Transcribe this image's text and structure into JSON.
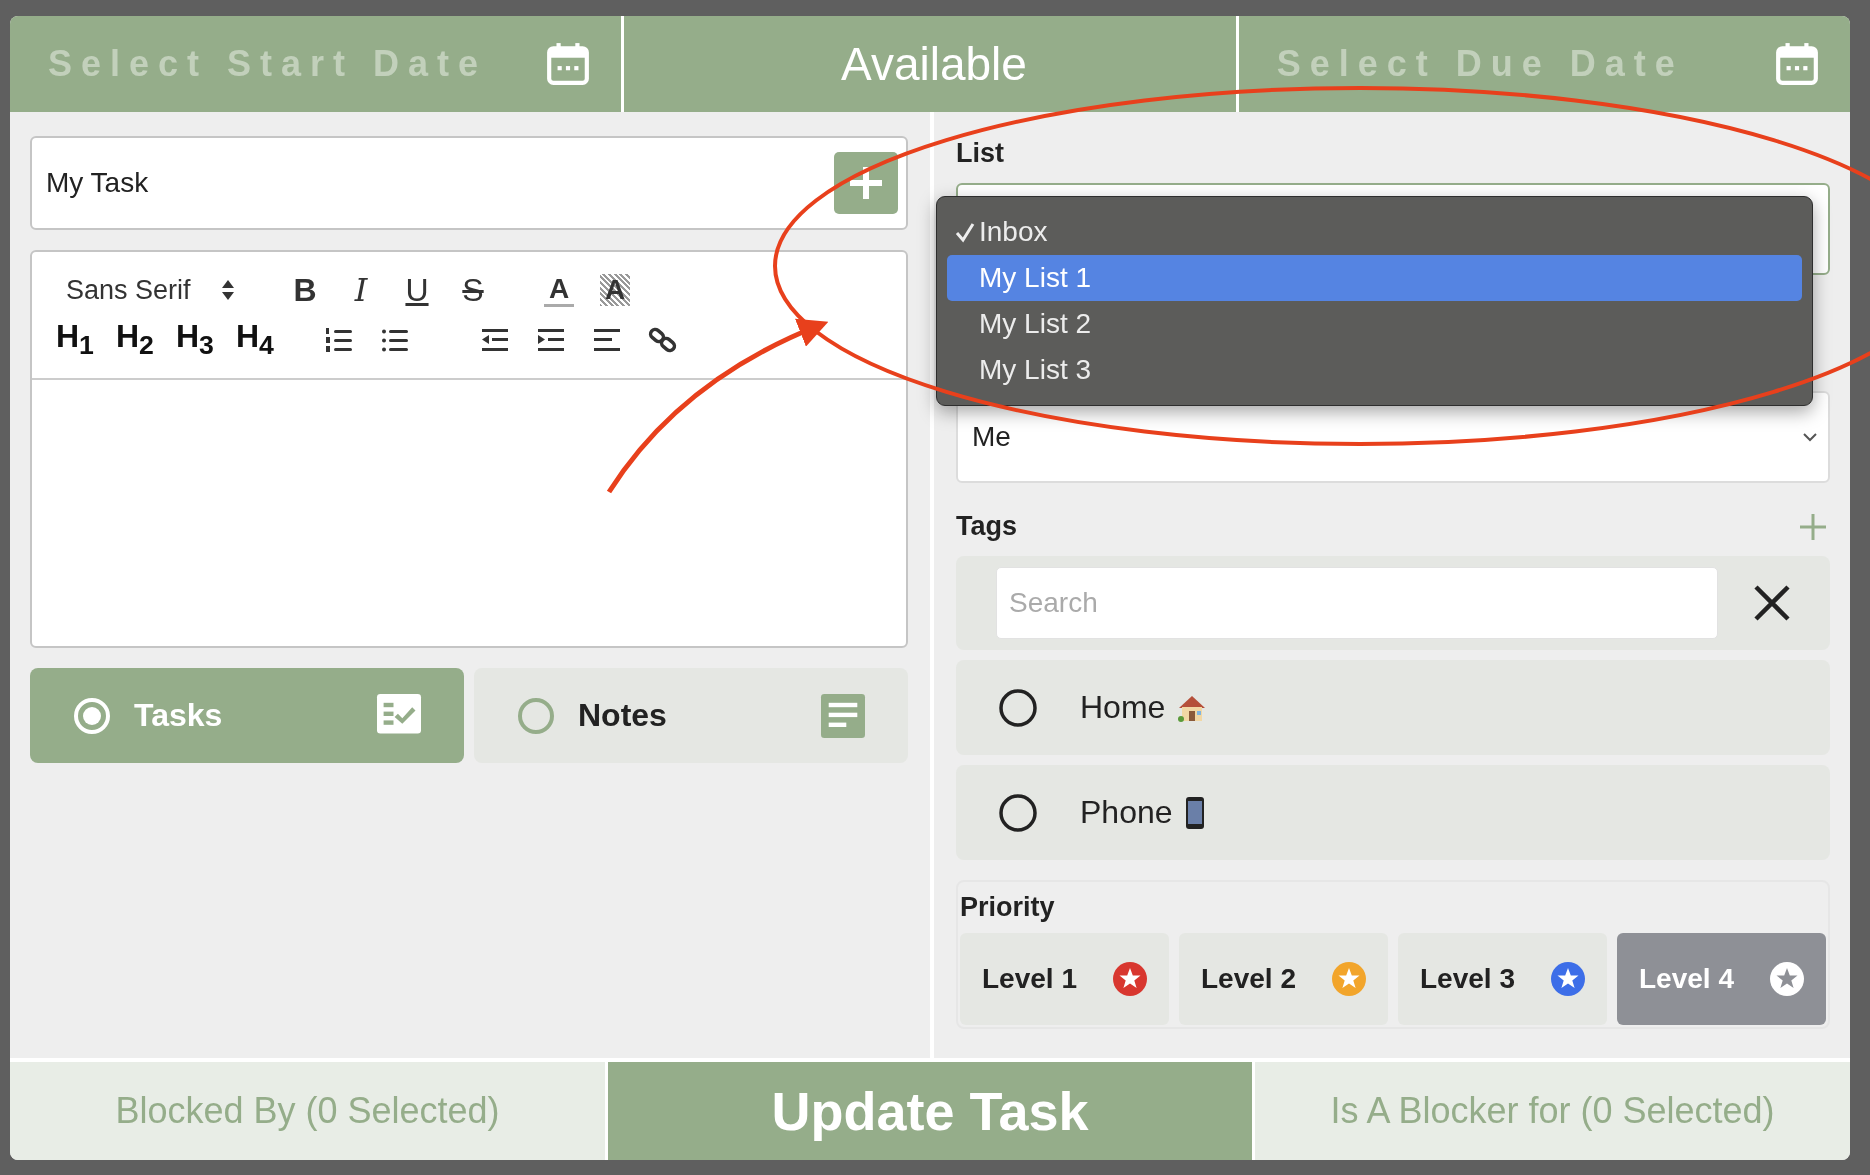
{
  "header": {
    "start_date": {
      "placeholder": "Select Start Date"
    },
    "status": "Available",
    "due_date": {
      "placeholder": "Select Due Date"
    }
  },
  "title_field": {
    "value": "My Task"
  },
  "editor": {
    "font": "Sans Serif",
    "format_buttons": [
      "B",
      "I",
      "U",
      "S",
      "A",
      "A"
    ],
    "headings": [
      "H$_{1}$",
      "H$_{2}$",
      "H$_{3}$",
      "H$_{4}$"
    ]
  },
  "type_options": [
    {
      "label": "Tasks",
      "selected": true
    },
    {
      "label": "Notes",
      "selected": false
    }
  ],
  "list": {
    "label": "List",
    "menu": [
      {
        "label": "Inbox",
        "checked": true,
        "highlighted": false
      },
      {
        "label": "My List 1",
        "checked": false,
        "highlighted": true
      },
      {
        "label": "My List 2",
        "checked": false,
        "highlighted": false
      },
      {
        "label": "My List 3",
        "checked": false,
        "highlighted": false
      }
    ]
  },
  "assignee": {
    "value": "Me"
  },
  "tags": {
    "label": "Tags",
    "search": {
      "placeholder": "Search"
    },
    "items": [
      {
        "label": "Home",
        "kind": "house",
        "selected": false
      },
      {
        "label": "Phone",
        "kind": "phone",
        "selected": false
      }
    ]
  },
  "priority": {
    "label": "Priority",
    "levels": [
      {
        "label": "Level 1",
        "color": "#d8372f",
        "selected": false
      },
      {
        "label": "Level 2",
        "color": "#f2a52b",
        "selected": false
      },
      {
        "label": "Level 3",
        "color": "#3d6ee8",
        "selected": false
      },
      {
        "label": "Level 4",
        "color": "#ffffff",
        "selected": true
      }
    ]
  },
  "footer": {
    "blocked_by": "Blocked By (0 Selected)",
    "action": "Update Task",
    "blocker_for": "Is A Blocker for (0 Selected)"
  }
}
